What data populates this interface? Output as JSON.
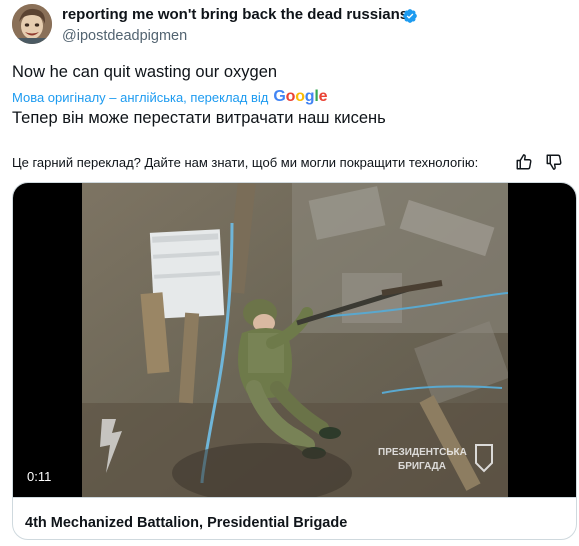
{
  "author": {
    "display_name": "reporting me won't bring back the dead russians",
    "handle": "@ipostdeadpigmen",
    "verified": true
  },
  "tweet": {
    "text": "Now he can quit wasting our oxygen",
    "translation_note": "Мова оригіналу – англійська, переклад від",
    "translation_provider": "Google",
    "translated_text": "Тепер він може перестати витрачати наш кисень"
  },
  "feedback": {
    "question": "Це гарний переклад? Дайте нам знати, щоб ми могли покращити технологію:"
  },
  "media": {
    "duration": "0:11",
    "watermark_line1": "ПРЕЗИДЕНТСЬКА",
    "watermark_line2": "БРИГАДА",
    "card_title": "4th Mechanized Battalion, Presidential Brigade"
  },
  "colors": {
    "accent": "#1d9bf0",
    "text": "#0f1419",
    "muted": "#536471",
    "border": "#cfd9de"
  },
  "icons": {
    "verified": "verified-badge-icon",
    "thumbs_up": "thumbs-up-icon",
    "thumbs_down": "thumbs-down-icon"
  }
}
